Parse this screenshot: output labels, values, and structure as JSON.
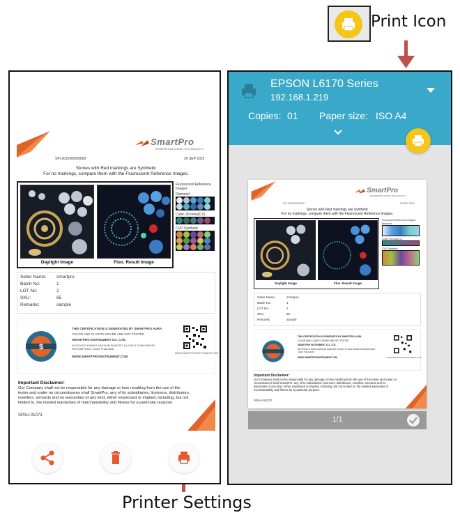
{
  "annotations": {
    "print_icon_label": "Print Icon",
    "printer_settings_label": "Printer Settings"
  },
  "report": {
    "brand": "SmartPro",
    "brand_tagline": "GENERATION AHEAD TECHNOLOGY",
    "report_id": "SPI 20220000/0000",
    "date": "20 SEP 2022",
    "note_line1": "Stones with Red markings are Synthetic",
    "note_line2": "For no markings, compare them with the Fluorescent Reference Images.",
    "reference_title": "Fluorescent Reference Images:",
    "ref_diamond": "Diamond",
    "ref_cz": "Cubic Zirconia(CZ)",
    "ref_cvd": "CVD Synthetic",
    "daylight_caption": "Daylight Image",
    "fluo_caption": "Fluo. Result Image",
    "fields": [
      {
        "key": "Seller Name:",
        "value": "smartpro"
      },
      {
        "key": "Batch No:",
        "value": "1"
      },
      {
        "key": "LOT No:",
        "value": "2"
      },
      {
        "key": "SKU:",
        "value": "65"
      },
      {
        "key": "Remarks:",
        "value": "sample"
      }
    ],
    "cert_line1": "THIS CERTIFICATION IS GENERATED BY SMARTPRO AURA",
    "cert_line2": "COLOR AND CLARITY GRADE ARE NOT TESTED",
    "cert_line3": "SMARTPRO INSTRUMENT CO., LTD.",
    "cert_line4": "94/70 MOO 8 BANG KAPHOM RANGSIT KLONG 3 THANYABURI PATHUMTHANI 12110 THAILAND",
    "cert_website": "WWW.SMARTPROINSTRUMENT.COM",
    "qr_caption": "WWW.SMARTPROINSTRUMENT.COM",
    "disclaimer_title": "Important Disclaimer:",
    "disclaimer_text": "Our Company shall not be responsible for any damage or loss resulting from the use of the tester and under no circumstances shall SmartPro, any of its subsidiaries, licensors, distributors, resellers, servants and no warranties of any kind, either expressed or implied, including, but not limited to, the implied warranties of merchantability and fitness for a particular purpose.",
    "serial": "SPAU-01073"
  },
  "printer": {
    "name": "EPSON L6170 Series",
    "ip": "192.168.1.219",
    "copies_label": "Copies:",
    "copies_value": "01",
    "paper_label": "Paper size:",
    "paper_value": "ISO A4",
    "page_indicator": "1/1"
  },
  "icons": {
    "share": "share-icon",
    "delete": "trash-icon",
    "print": "printer-icon",
    "dropdown": "chevron-down-icon",
    "check": "check-icon"
  },
  "colors": {
    "accent_orange": "#e2632a",
    "print_yellow": "#f5c518",
    "teal_header": "#3aa9c9",
    "icon_red": "#e45a2c",
    "annotation_arrow": "#c0504d"
  }
}
